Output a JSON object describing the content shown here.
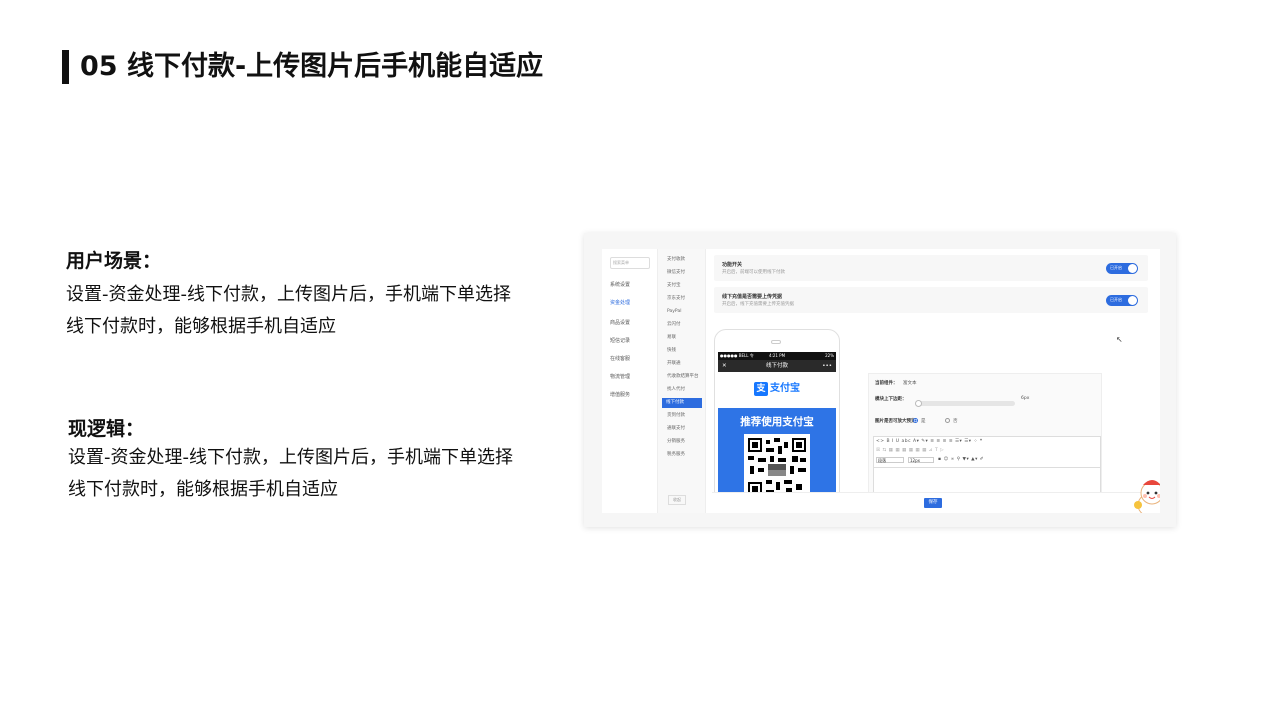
{
  "slide": {
    "title": "05 线下付款-上传图片后手机能自适应",
    "scenario_heading": "用户场景：",
    "scenario_text": "设置-资金处理-线下付款，上传图片后，手机端下单选择线下付款时，能够根据手机自适应",
    "logic_heading": "现逻辑：",
    "logic_text": "设置-资金处理-线下付款，上传图片后，手机端下单选择线下付款时，能够根据手机自适应"
  },
  "screenshot": {
    "search_placeholder": "搜索菜单",
    "sidebar": [
      "系统设置",
      "资金处理",
      "商品设置",
      "短信记录",
      "在线客服",
      "物流管理",
      "增值服务"
    ],
    "submenu": [
      "支付收款",
      "微信支付",
      "支付宝",
      "京东支付",
      "PayPal",
      "云闪付",
      "易联",
      "快钱",
      "开联通",
      "代收款结算平台",
      "找人代付",
      "线下付款",
      "货到付款",
      "通联支付",
      "分销服务",
      "税务服务"
    ],
    "back_label": "收起",
    "card1_title": "功能开关",
    "card1_desc": "开启后，前端可以使用线下付款",
    "card2_title": "线下充值是否需要上传凭据",
    "card2_desc": "开启后，线下充值需要上传充值凭据",
    "toggle_label": "已开启",
    "phone_status_left": "●●●●● BELL 令",
    "phone_status_center": "4:21 PM",
    "phone_status_right": "22%",
    "phone_title": "线下付款",
    "phone_close": "✕",
    "phone_menu": "•••",
    "alipay_logo": "支",
    "alipay_name": "支付宝",
    "alipay_promo": "推荐使用支付宝",
    "panel_widget_label": "当前组件：",
    "panel_widget_value": "富文本",
    "panel_margin_label": "模块上下边距：",
    "panel_margin_value": "6px",
    "panel_zoom_label": "图片是否可放大预览：",
    "panel_yes": "是",
    "panel_no": "否",
    "editor_tools_row1": "<> B I U abc A▾ ✎▾ ≡ ≡ ≡ ≡ ☰▾ ☰▾ ⁘ ❝",
    "editor_tools_row2": "☒ ⇆ ▦ ▦ ▦ ▦ ▦ ▦ ⊿ T ▷",
    "editor_para": "段落",
    "editor_size": "12px",
    "editor_tools_row3": "▪ ☺ ∞ ⚲ ▼▾ ▲▾ ✐",
    "save_label": "保存",
    "cursor": "↖"
  },
  "colors": {
    "accent": "#2d6cdf",
    "alipay_blue": "#1677ff",
    "phone_bg": "#2e74e6"
  }
}
